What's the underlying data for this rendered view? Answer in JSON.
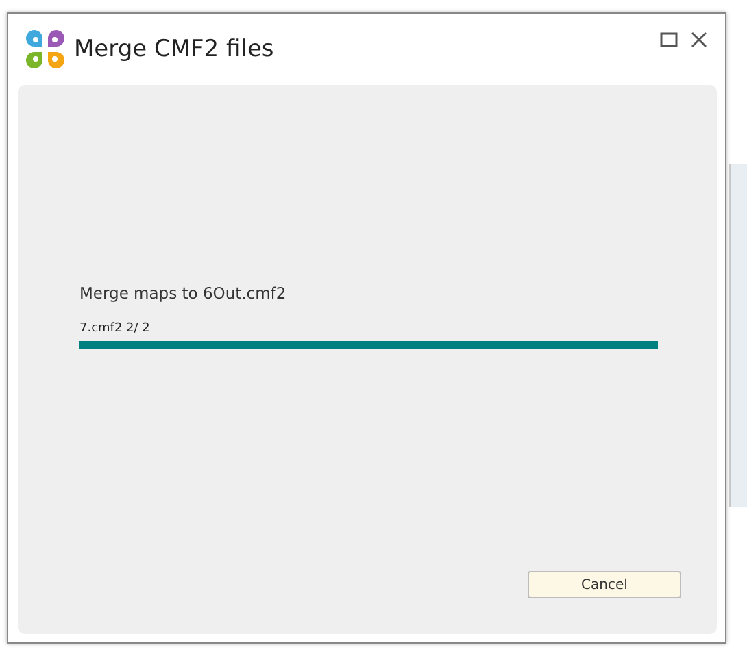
{
  "dialog": {
    "title": "Merge CMF2 files",
    "message": "Merge maps to 6Out.cmf2",
    "progress": {
      "label": "7.cmf2 2/ 2",
      "level": 1.0
    },
    "buttons": [
      "Cancel"
    ]
  }
}
